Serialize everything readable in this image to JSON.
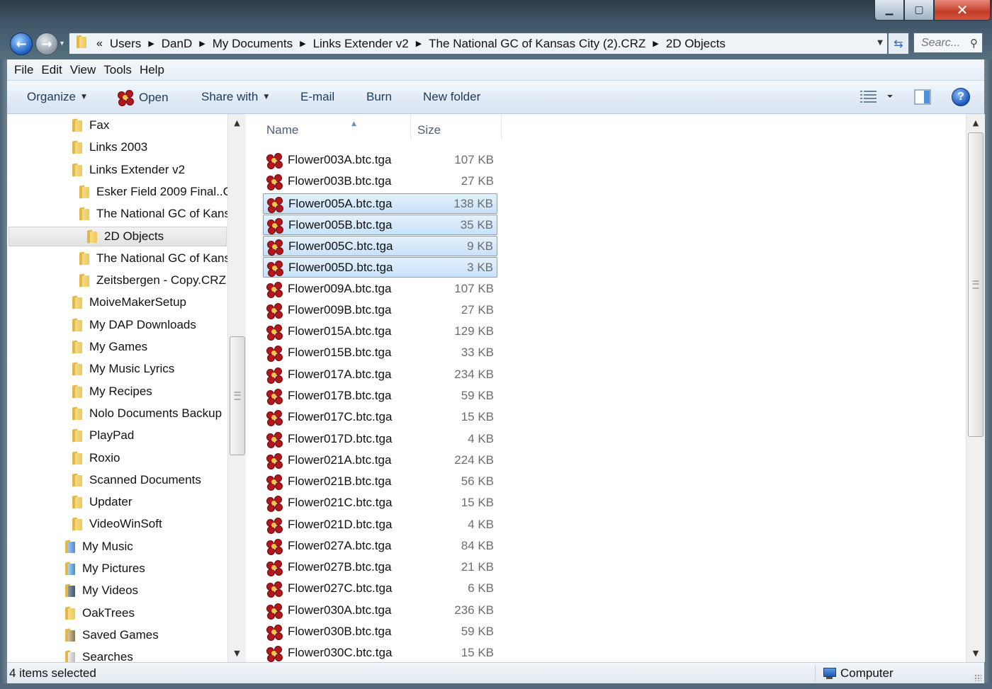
{
  "window": {
    "controls": {
      "minimize": "▁",
      "maximize": "▢",
      "close": "✕"
    }
  },
  "navigation": {
    "back_glyph": "←",
    "forward_glyph": "→",
    "overflow": "«",
    "breadcrumbs": [
      "Users",
      "DanD",
      "My Documents",
      "Links Extender v2",
      "The National GC of Kansas City (2).CRZ",
      "2D Objects"
    ],
    "search_placeholder": "Searc..."
  },
  "menubar": [
    "File",
    "Edit",
    "View",
    "Tools",
    "Help"
  ],
  "commandbar": {
    "organize": "Organize",
    "open": "Open",
    "share_with": "Share with",
    "email": "E-mail",
    "burn": "Burn",
    "new_folder": "New folder",
    "help": "?"
  },
  "navpane": {
    "items": [
      {
        "label": "Fax",
        "indent": 2,
        "icon": "folder-icon"
      },
      {
        "label": "Links 2003",
        "indent": 2,
        "icon": "folder-icon"
      },
      {
        "label": "Links Extender v2",
        "indent": 2,
        "icon": "folder-icon"
      },
      {
        "label": "Esker Field 2009 Final..C",
        "indent": 3,
        "icon": "folder-icon"
      },
      {
        "label": "The National GC of Kans",
        "indent": 3,
        "icon": "folder-icon"
      },
      {
        "label": "2D Objects",
        "indent": 4,
        "icon": "folder-icon",
        "selected": true
      },
      {
        "label": "The National GC of Kans",
        "indent": 3,
        "icon": "folder-icon"
      },
      {
        "label": "Zeitsbergen - Copy.CRZ",
        "indent": 3,
        "icon": "folder-icon"
      },
      {
        "label": "MoiveMakerSetup",
        "indent": 2,
        "icon": "folder-icon"
      },
      {
        "label": "My DAP Downloads",
        "indent": 2,
        "icon": "folder-icon"
      },
      {
        "label": "My Games",
        "indent": 2,
        "icon": "folder-icon"
      },
      {
        "label": "My Music Lyrics",
        "indent": 2,
        "icon": "folder-icon"
      },
      {
        "label": "My Recipes",
        "indent": 2,
        "icon": "folder-icon"
      },
      {
        "label": "Nolo Documents Backup",
        "indent": 2,
        "icon": "folder-icon"
      },
      {
        "label": "PlayPad",
        "indent": 2,
        "icon": "folder-icon"
      },
      {
        "label": "Roxio",
        "indent": 2,
        "icon": "folder-icon"
      },
      {
        "label": "Scanned Documents",
        "indent": 2,
        "icon": "folder-icon"
      },
      {
        "label": "Updater",
        "indent": 2,
        "icon": "folder-icon"
      },
      {
        "label": "VideoWinSoft",
        "indent": 2,
        "icon": "folder-icon"
      },
      {
        "label": "My Music",
        "indent": 1,
        "icon": "music-folder-icon"
      },
      {
        "label": "My Pictures",
        "indent": 1,
        "icon": "pictures-folder-icon"
      },
      {
        "label": "My Videos",
        "indent": 1,
        "icon": "videos-folder-icon"
      },
      {
        "label": "OakTrees",
        "indent": 1,
        "icon": "folder-icon"
      },
      {
        "label": "Saved Games",
        "indent": 1,
        "icon": "saved-games-folder-icon"
      },
      {
        "label": "Searches",
        "indent": 1,
        "icon": "searches-folder-icon"
      }
    ]
  },
  "filelist": {
    "columns": {
      "name": "Name",
      "size": "Size"
    },
    "files": [
      {
        "name": "Flower003A.btc.tga",
        "size": "107 KB",
        "selected": false
      },
      {
        "name": "Flower003B.btc.tga",
        "size": "27 KB",
        "selected": false
      },
      {
        "name": "Flower005A.btc.tga",
        "size": "138 KB",
        "selected": true
      },
      {
        "name": "Flower005B.btc.tga",
        "size": "35 KB",
        "selected": true
      },
      {
        "name": "Flower005C.btc.tga",
        "size": "9 KB",
        "selected": true
      },
      {
        "name": "Flower005D.btc.tga",
        "size": "3 KB",
        "selected": true
      },
      {
        "name": "Flower009A.btc.tga",
        "size": "107 KB",
        "selected": false
      },
      {
        "name": "Flower009B.btc.tga",
        "size": "27 KB",
        "selected": false
      },
      {
        "name": "Flower015A.btc.tga",
        "size": "129 KB",
        "selected": false
      },
      {
        "name": "Flower015B.btc.tga",
        "size": "33 KB",
        "selected": false
      },
      {
        "name": "Flower017A.btc.tga",
        "size": "234 KB",
        "selected": false
      },
      {
        "name": "Flower017B.btc.tga",
        "size": "59 KB",
        "selected": false
      },
      {
        "name": "Flower017C.btc.tga",
        "size": "15 KB",
        "selected": false
      },
      {
        "name": "Flower017D.btc.tga",
        "size": "4 KB",
        "selected": false
      },
      {
        "name": "Flower021A.btc.tga",
        "size": "224 KB",
        "selected": false
      },
      {
        "name": "Flower021B.btc.tga",
        "size": "56 KB",
        "selected": false
      },
      {
        "name": "Flower021C.btc.tga",
        "size": "15 KB",
        "selected": false
      },
      {
        "name": "Flower021D.btc.tga",
        "size": "4 KB",
        "selected": false
      },
      {
        "name": "Flower027A.btc.tga",
        "size": "84 KB",
        "selected": false
      },
      {
        "name": "Flower027B.btc.tga",
        "size": "21 KB",
        "selected": false
      },
      {
        "name": "Flower027C.btc.tga",
        "size": "6 KB",
        "selected": false
      },
      {
        "name": "Flower030A.btc.tga",
        "size": "236 KB",
        "selected": false
      },
      {
        "name": "Flower030B.btc.tga",
        "size": "59 KB",
        "selected": false
      },
      {
        "name": "Flower030C.btc.tga",
        "size": "15 KB",
        "selected": false
      }
    ]
  },
  "statusbar": {
    "selection": "4 items selected",
    "location": "Computer"
  },
  "colors": {
    "selection_bg": "#cce4f9",
    "selection_border": "#7da2ce",
    "command_text": "#1e3a5c"
  }
}
